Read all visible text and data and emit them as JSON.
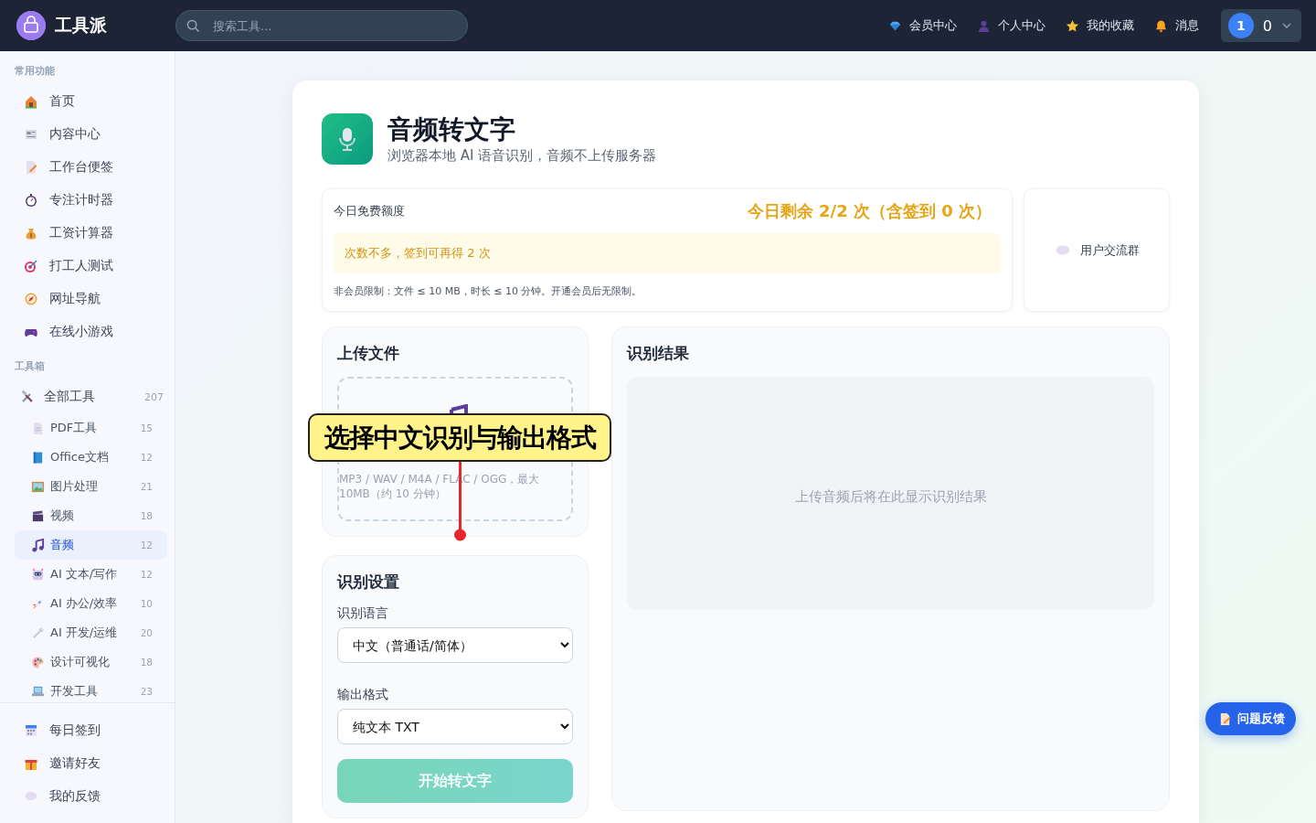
{
  "header": {
    "logo_text": "工具派",
    "search": {
      "placeholder": "搜索工具..."
    },
    "links": [
      {
        "label": "会员中心"
      },
      {
        "label": "个人中心"
      },
      {
        "label": "我的收藏"
      },
      {
        "label": "消息"
      }
    ],
    "user": {
      "avatar": "1",
      "count": "0"
    }
  },
  "sidebar": {
    "sections": [
      {
        "title": "常用功能",
        "items": [
          {
            "label": "首页",
            "selected": false
          },
          {
            "label": "内容中心",
            "selected": false
          },
          {
            "label": "工作台便签",
            "selected": false
          },
          {
            "label": "专注计时器",
            "selected": false
          },
          {
            "label": "工资计算器",
            "selected": false
          },
          {
            "label": "打工人测试",
            "selected": false
          },
          {
            "label": "网址导航",
            "selected": false
          },
          {
            "label": "在线小游戏",
            "selected": false
          }
        ]
      },
      {
        "title": "工具箱",
        "items": [
          {
            "label": "全部工具",
            "count": "207",
            "selected": false,
            "children": [
              {
                "label": "PDF工具",
                "count": "15",
                "selected": false
              },
              {
                "label": "Office文档",
                "count": "12",
                "selected": false
              },
              {
                "label": "图片处理",
                "count": "21",
                "selected": false
              },
              {
                "label": "视频",
                "count": "18",
                "selected": false
              },
              {
                "label": "音频",
                "count": "12",
                "selected": true
              },
              {
                "label": "AI 文本/写作",
                "count": "12",
                "selected": false
              },
              {
                "label": "AI 办公/效率",
                "count": "10",
                "selected": false
              },
              {
                "label": "AI 开发/运维",
                "count": "20",
                "selected": false
              },
              {
                "label": "设计可视化",
                "count": "18",
                "selected": false
              },
              {
                "label": "开发工具",
                "count": "23",
                "selected": false
              }
            ]
          }
        ]
      }
    ],
    "footer_items": [
      {
        "label": "每日签到"
      },
      {
        "label": "邀请好友"
      },
      {
        "label": "我的反馈"
      }
    ]
  },
  "page": {
    "title": "音频转文字",
    "subtitle": "浏览器本地 AI 语音识别，音频不上传服务器",
    "quota": {
      "label": "今日免费额度",
      "remaining": "今日剩余 2/2 次（含签到 0 次）",
      "notice": "次数不多，签到可再得 2 次",
      "limits": "非会员限制：文件 ≤ 10 MB，时长 ≤ 10 分钟。开通会员后无限制。"
    },
    "community": {
      "label": "用户交流群"
    },
    "upload": {
      "title": "上传文件",
      "hint": "MP3 / WAV / M4A / FLAC / OGG，最大 10MB（约 10 分钟）"
    },
    "settings": {
      "title": "识别设置",
      "fields": [
        {
          "label": "识别语言",
          "value": "中文（普通话/简体）"
        },
        {
          "label": "输出格式",
          "value": "纯文本 TXT"
        }
      ],
      "button": {
        "label": "开始转文字",
        "disabled": true
      }
    },
    "result": {
      "title": "识别结果",
      "empty_message": "上传音频后将在此显示识别结果"
    }
  },
  "annotation": {
    "text": "选择中文识别与输出格式"
  },
  "feedback_button": {
    "label": "问题反馈"
  }
}
